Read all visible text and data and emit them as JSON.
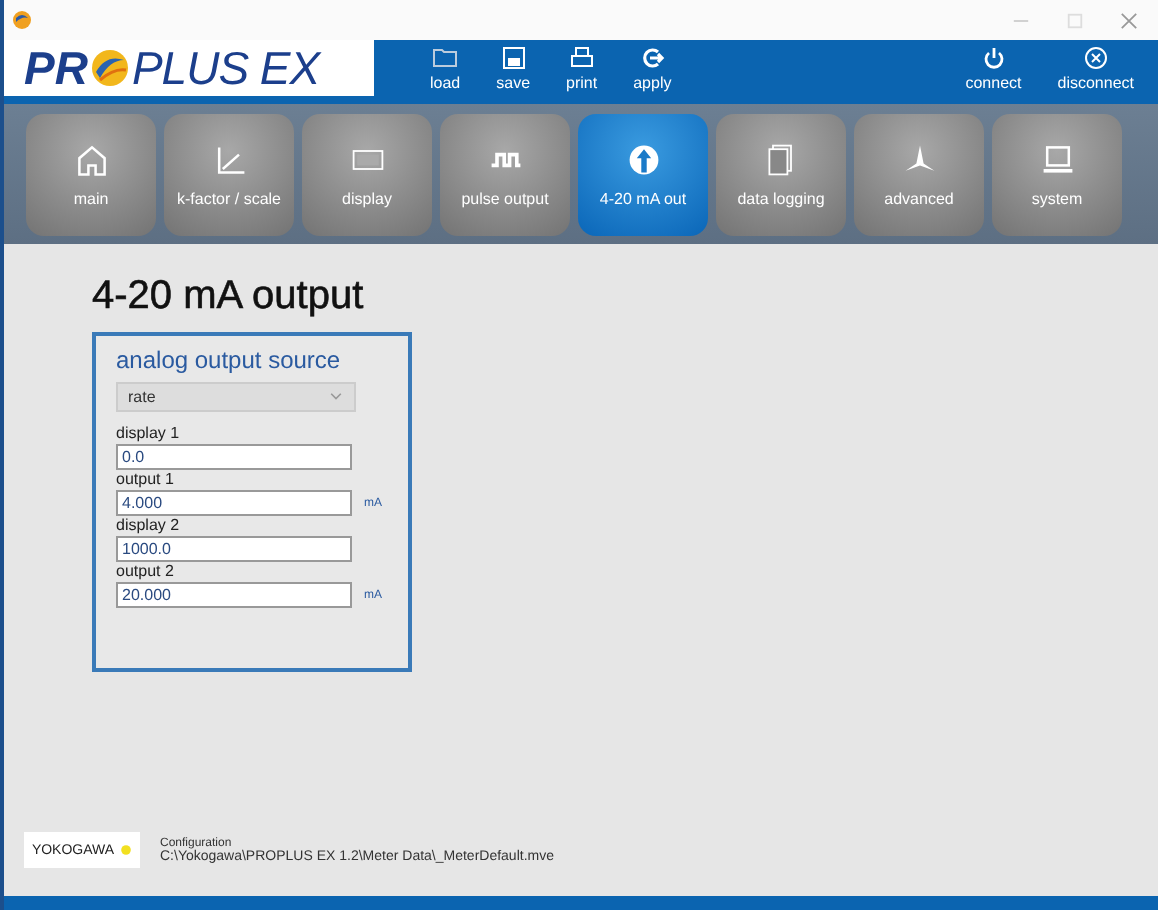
{
  "logo": {
    "before": "PR",
    "after": "PLUS EX"
  },
  "toolbar": {
    "left": [
      {
        "label": "load"
      },
      {
        "label": "save"
      },
      {
        "label": "print"
      },
      {
        "label": "apply"
      }
    ],
    "right": [
      {
        "label": "connect"
      },
      {
        "label": "disconnect"
      }
    ]
  },
  "tabs": [
    {
      "label": "main",
      "selected": false
    },
    {
      "label": "k-factor / scale",
      "selected": false
    },
    {
      "label": "display",
      "selected": false
    },
    {
      "label": "pulse output",
      "selected": false
    },
    {
      "label": "4-20 mA out",
      "selected": true
    },
    {
      "label": "data logging",
      "selected": false
    },
    {
      "label": "advanced",
      "selected": false
    },
    {
      "label": "system",
      "selected": false
    }
  ],
  "page_title": "4-20 mA output",
  "panel": {
    "title": "analog output source",
    "source": "rate",
    "fields": [
      {
        "label": "display 1",
        "value": "0.0"
      },
      {
        "label": "output 1",
        "value": "4.000",
        "unit": "mA"
      },
      {
        "label": "display 2",
        "value": "1000.0"
      },
      {
        "label": "output 2",
        "value": "20.000",
        "unit": "mA"
      }
    ]
  },
  "footer": {
    "brand": "YOKOGAWA",
    "caption": "Configuration",
    "path": "C:\\Yokogawa\\PROPLUS EX 1.2\\Meter Data\\_MeterDefault.mve"
  }
}
